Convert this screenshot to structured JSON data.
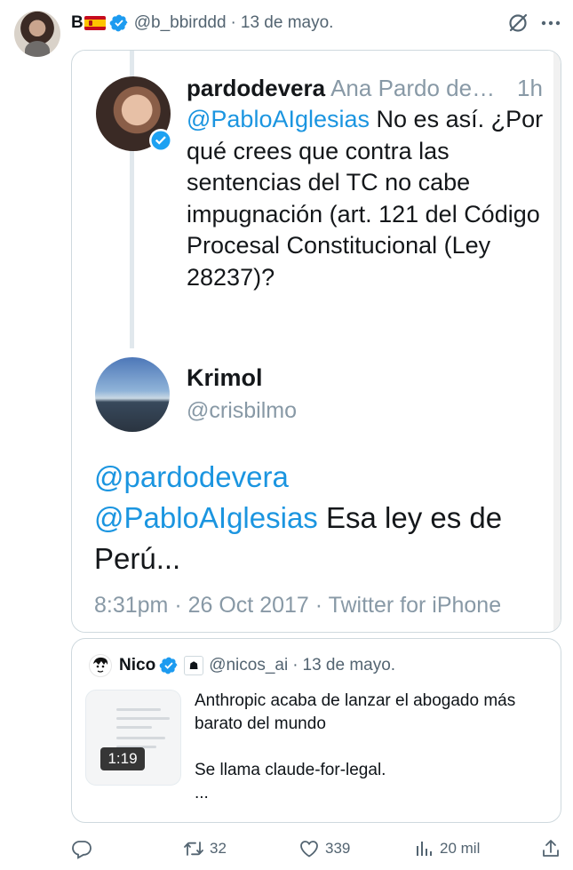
{
  "tweet": {
    "display_name": "B",
    "handle": "@b_bbirddd",
    "separator": "·",
    "date": "13 de mayo."
  },
  "screenshot": {
    "reply": {
      "username": "pardodevera",
      "name_truncated": "Ana Pardo de…",
      "time": "1h",
      "mention": "@PabloAIglesias",
      "text": " No es así. ¿Por qué crees que contra las sentencias del TC no cabe impugnación (art. 121 del Código Procesal Constitucional (Ley 28237)?"
    },
    "main": {
      "name": "Krimol",
      "handle": "@crisbilmo",
      "mention_1": "@pardodevera",
      "mention_2": "@PabloAIglesias",
      "text": " Esa ley es de Perú...",
      "footer": "8:31pm · 26 Oct 2017 · Twitter for iPhone"
    }
  },
  "quote": {
    "name": "Nico",
    "handle": "@nicos_ai",
    "separator": "·",
    "date": "13 de mayo.",
    "video_duration": "1:19",
    "text": "Anthropic acaba de lanzar el abogado más barato del mundo\n\nSe llama claude-for-legal.\n..."
  },
  "actions": {
    "reply_count": "",
    "retweet_count": "32",
    "like_count": "339",
    "view_count": "20 mil"
  },
  "colors": {
    "accent": "#1d9bf0",
    "muted": "#536471",
    "legacy_link": "#1b95e0"
  }
}
